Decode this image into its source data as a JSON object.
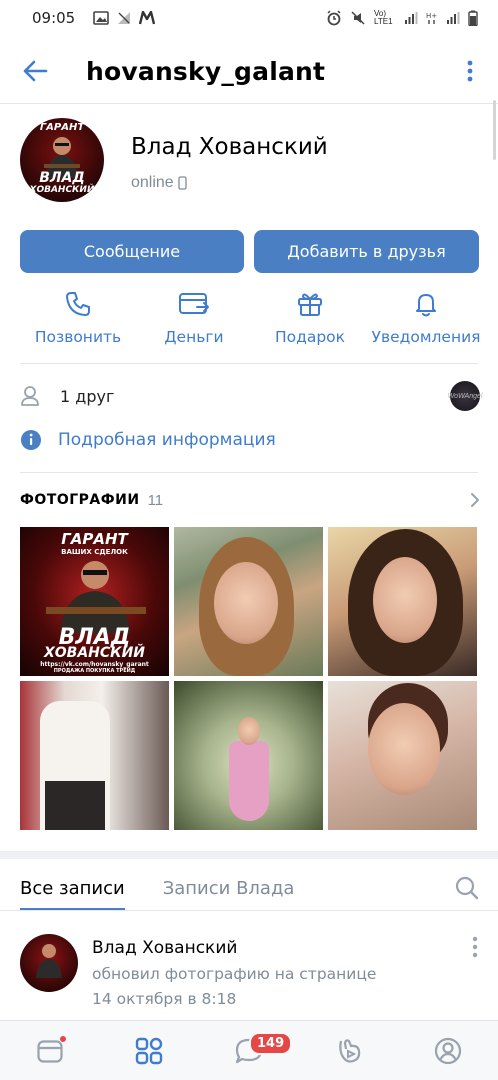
{
  "status_bar": {
    "time": "09:05",
    "network": "Vo) LTE1"
  },
  "header": {
    "title": "hovansky_galant"
  },
  "profile": {
    "name": "Влад Хованский",
    "status": "online",
    "avatar_text_top": "ГАРАНТ",
    "avatar_text_mid": "ВЛАД",
    "avatar_text_bottom": "ХОВАНСКИЙ"
  },
  "buttons": {
    "message": "Сообщение",
    "add_friend": "Добавить в друзья"
  },
  "actions": [
    {
      "label": "Позвонить",
      "icon": "phone-icon"
    },
    {
      "label": "Деньги",
      "icon": "money-transfer-icon"
    },
    {
      "label": "Подарок",
      "icon": "gift-icon"
    },
    {
      "label": "Уведомления",
      "icon": "bell-icon"
    }
  ],
  "friends": {
    "label": "1 друг",
    "mini_avatar_text": "WoWAngel"
  },
  "info": {
    "label": "Подробная информация"
  },
  "photos": {
    "title": "ФОТОГРАФИИ",
    "count": "11",
    "p1_top": "ГАРАНТ",
    "p1_sub": "ВАШИХ СДЕЛОК",
    "p1_name1": "ВЛАД",
    "p1_name2": "ХОВАНСКИЙ",
    "p1_url": "https://vk.com/hovansky_garant",
    "p1_caption": "ПРОДАЖА ПОКУПКА ТРЕЙД"
  },
  "tabs": {
    "all_posts": "Все записи",
    "user_posts": "Записи Влада"
  },
  "post": {
    "author": "Влад Хованский",
    "action": "обновил фотографию на странице",
    "date": "14 октября в 8:18"
  },
  "bottom_nav": {
    "messages_badge": "149"
  },
  "colors": {
    "accent": "#4a7fc4",
    "link": "#3f7ccf",
    "secondary_text": "#818c99",
    "badge": "#e64646"
  }
}
